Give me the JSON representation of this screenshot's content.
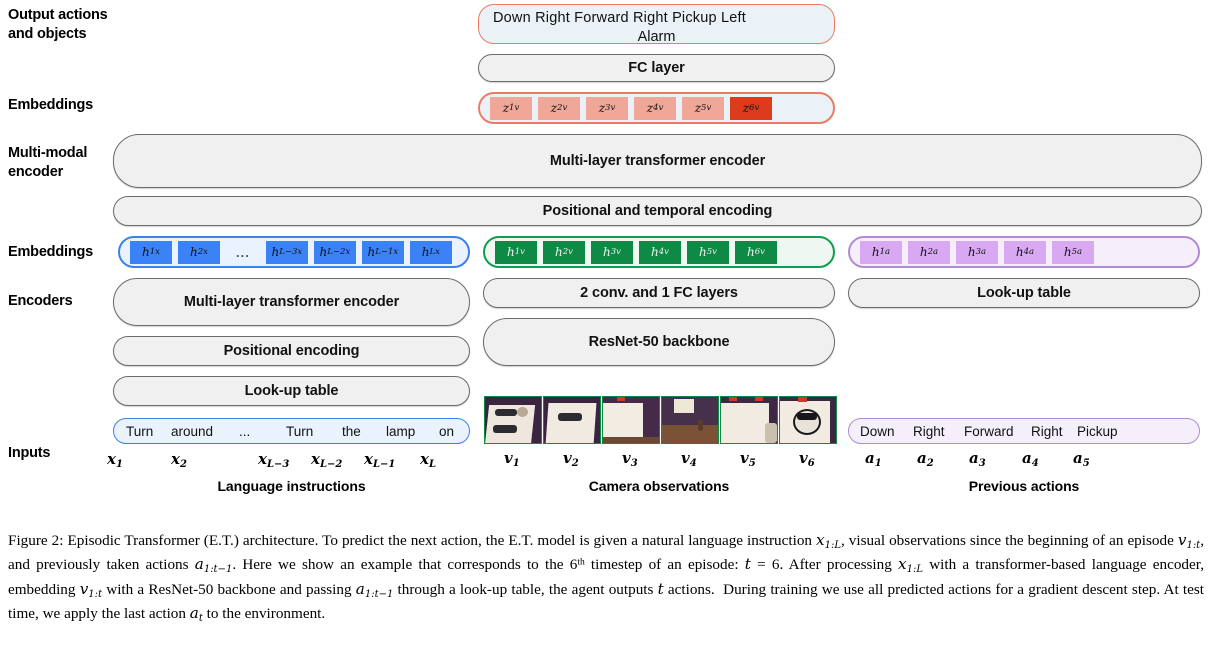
{
  "figure": {
    "row_labels": [
      {
        "id": "output-actions",
        "text": "Output actions\nand objects"
      },
      {
        "id": "embeddings-top",
        "text": "Embeddings"
      },
      {
        "id": "multi-modal-encoder",
        "text": "Multi-modal\nencoder"
      },
      {
        "id": "embeddings-mid",
        "text": "Embeddings"
      },
      {
        "id": "encoders",
        "text": "Encoders"
      },
      {
        "id": "inputs",
        "text": "Inputs"
      }
    ],
    "output_box": {
      "line1": "Down  Right  Forward Right Pickup  Left",
      "line2": "Alarm",
      "border_color": "#ec7b64",
      "fill_color": "#eaf2f7"
    },
    "fc_layer": {
      "label": "FC layer"
    },
    "output_embeddings": {
      "tokens": [
        "z1v",
        "z2v",
        "z3v",
        "z4v",
        "z5v",
        "z6v"
      ],
      "highlight_index": 5,
      "color": "#f0a797",
      "highlight_color": "#dd3c1c"
    },
    "multimodal": {
      "encoder_label": "Multi-layer transformer encoder",
      "positional_label": "Positional and temporal encoding"
    },
    "language_embeddings": {
      "tokens": [
        "h1x",
        "h2x",
        "hL-3x",
        "hL-2x",
        "hL-1x",
        "hLx"
      ],
      "ellipsis": "...",
      "color": "#3b82f6",
      "border_color": "#3b82e8"
    },
    "visual_embeddings": {
      "tokens": [
        "h1v",
        "h2v",
        "h3v",
        "h4v",
        "h5v",
        "h6v"
      ],
      "color": "#0e8a44",
      "border_color": "#119d4e"
    },
    "action_embeddings": {
      "tokens": [
        "h1a",
        "h2a",
        "h3a",
        "h4a",
        "h5a"
      ],
      "color": "#d9a8f2",
      "border_color": "#b18ad4"
    },
    "language_column": {
      "encoder_label": "Multi-layer transformer encoder",
      "positional_label": "Positional encoding",
      "lookup_label": "Look-up table",
      "input_words": [
        "Turn",
        "around",
        "...",
        "Turn",
        "the",
        "lamp",
        "on"
      ],
      "input_labels": [
        "x1",
        "x2",
        "xL-3",
        "xL-2",
        "xL-1",
        "xL"
      ],
      "caption": "Language instructions"
    },
    "vision_column": {
      "conv_label": "2 conv. and 1 FC layers",
      "backbone_label": "ResNet-50 backbone",
      "frame_labels": [
        "v1",
        "v2",
        "v3",
        "v4",
        "v5",
        "v6"
      ],
      "caption": "Camera observations"
    },
    "action_column": {
      "lookup_label": "Look-up table",
      "input_words": [
        "Down",
        "Right",
        "Forward",
        "Right",
        "Pickup"
      ],
      "input_labels": [
        "a1",
        "a2",
        "a3",
        "a4",
        "a5"
      ],
      "caption": "Previous actions"
    }
  },
  "caption": {
    "number": "Figure 2:",
    "text": "Episodic Transformer (E.T.) architecture. To predict the next action, the E.T. model is given a natural language instruction x1:L, visual observations since the beginning of an episode v1:t, and previously taken actions a1:t-1. Here we show an example that corresponds to the 6th timestep of an episode: t = 6. After processing x1:L with a transformer-based language encoder, embedding v1:t with a ResNet-50 backbone and passing a1:t-1 through a look-up table, the agent outputs t actions. During training we use all predicted actions for a gradient descent step. At test time, we apply the last action at to the environment."
  }
}
